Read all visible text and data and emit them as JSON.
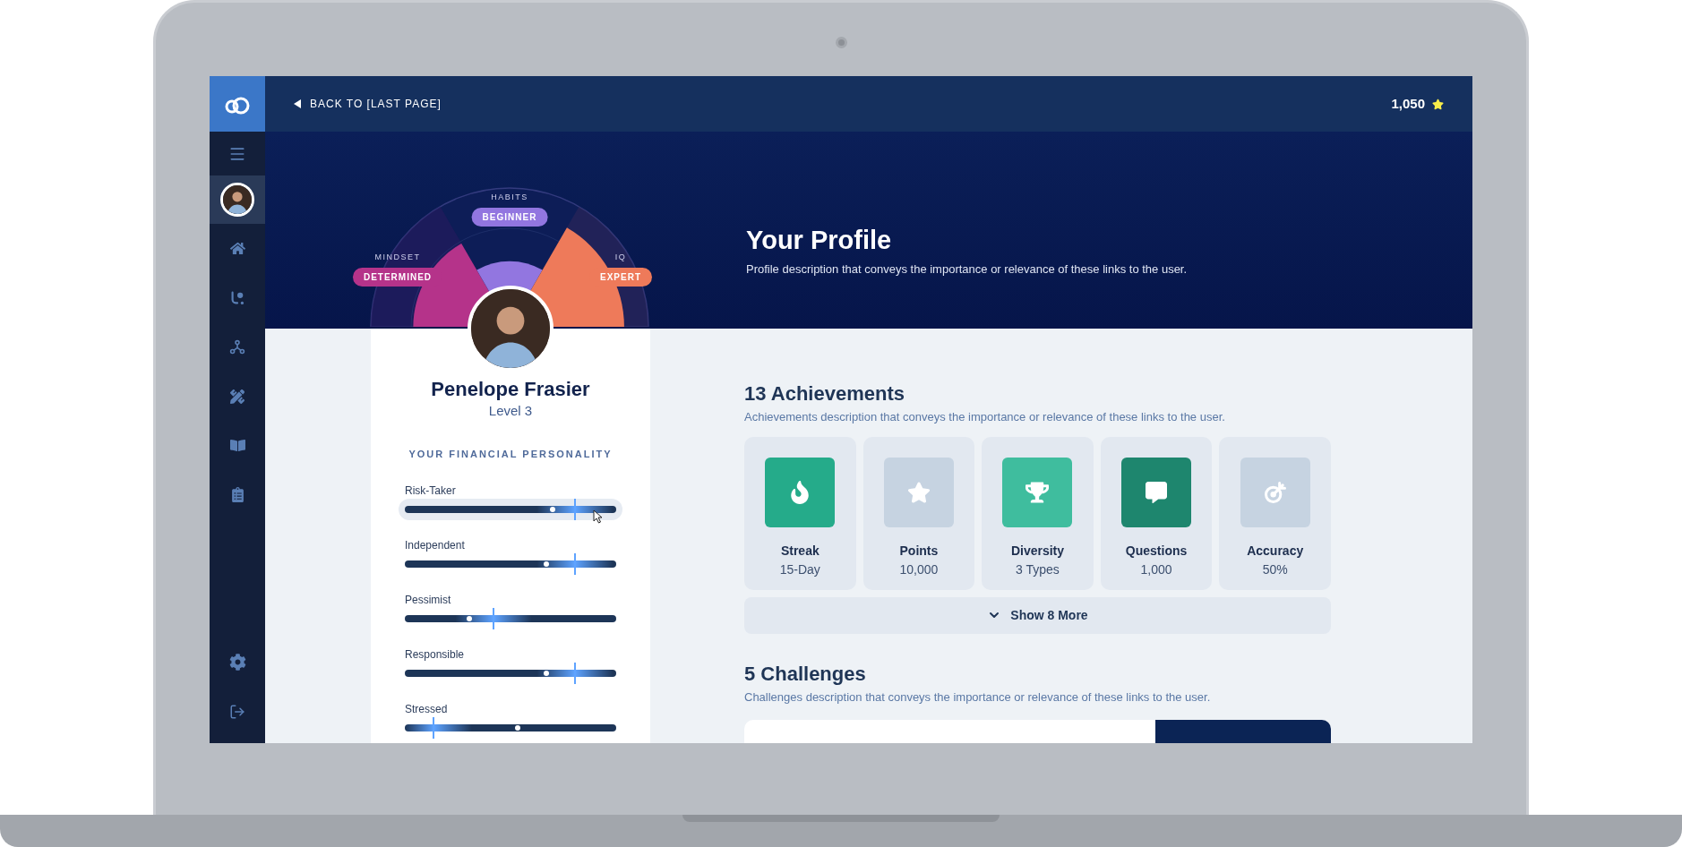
{
  "sidebar": {
    "items": [
      {
        "kind": "menu",
        "selected": false
      },
      {
        "kind": "profile",
        "selected": true
      },
      {
        "kind": "home",
        "selected": false
      },
      {
        "kind": "connections",
        "selected": false
      },
      {
        "kind": "network",
        "selected": false
      },
      {
        "kind": "tools",
        "selected": false
      },
      {
        "kind": "book",
        "selected": false
      },
      {
        "kind": "clipboard",
        "selected": false
      }
    ],
    "bottom_items": [
      {
        "kind": "settings",
        "selected": false
      },
      {
        "kind": "logout",
        "selected": false
      }
    ]
  },
  "header": {
    "back_label": "BACK TO [LAST PAGE]",
    "points": "1,050"
  },
  "hero": {
    "title": "Your Profile",
    "description": "Profile description that conveys the importance or relevance of these links to the user."
  },
  "personality_wheel": {
    "segments": [
      {
        "label": "MINDSET",
        "value": "DETERMINED",
        "color": "#b5338a",
        "level": 0.69
      },
      {
        "label": "HABITS",
        "value": "BEGINNER",
        "color": "#9276e0",
        "level": 0.47
      },
      {
        "label": "IQ",
        "value": "EXPERT",
        "color": "#ee7a5a",
        "level": 0.82
      }
    ]
  },
  "profile": {
    "name": "Penelope Frasier",
    "level": "Level 3",
    "section_title": "YOUR FINANCIAL PERSONALITY",
    "traits": [
      {
        "label": "Risk-Taker",
        "selected": true,
        "level": 0.805,
        "marker": {
          "level": 0.7
        }
      },
      {
        "label": "Independent",
        "selected": false,
        "level": 0.805,
        "marker": {
          "level": 0.67
        }
      },
      {
        "label": "Pessimist",
        "selected": false,
        "level": 0.42,
        "marker": {
          "level": 0.305
        }
      },
      {
        "label": "Responsible",
        "selected": false,
        "level": 0.805,
        "marker": {
          "level": 0.67
        }
      },
      {
        "label": "Stressed",
        "selected": false,
        "level": 0.137,
        "marker": {
          "level": 0.535
        }
      }
    ]
  },
  "achievements": {
    "title": "13 Achievements",
    "description": "Achievements description that conveys the importance or relevance of these links to the user.",
    "items": [
      {
        "kind": "streak",
        "label": "Streak",
        "value": "15-Day",
        "color": "#25ab8a"
      },
      {
        "kind": "points",
        "label": "Points",
        "value": "10,000",
        "color": "#c6d3e1"
      },
      {
        "kind": "diversity",
        "label": "Diversity",
        "value": "3 Types",
        "color": "#3fbd9e"
      },
      {
        "kind": "questions",
        "label": "Questions",
        "value": "1,000",
        "color": "#1e866e"
      },
      {
        "kind": "accuracy",
        "label": "Accuracy",
        "value": "50%",
        "color": "#c6d3e1"
      }
    ],
    "show_more": "Show 8 More"
  },
  "challenges": {
    "title": "5 Challenges",
    "description": "Challenges description that conveys the importance or relevance of these links to the user."
  }
}
